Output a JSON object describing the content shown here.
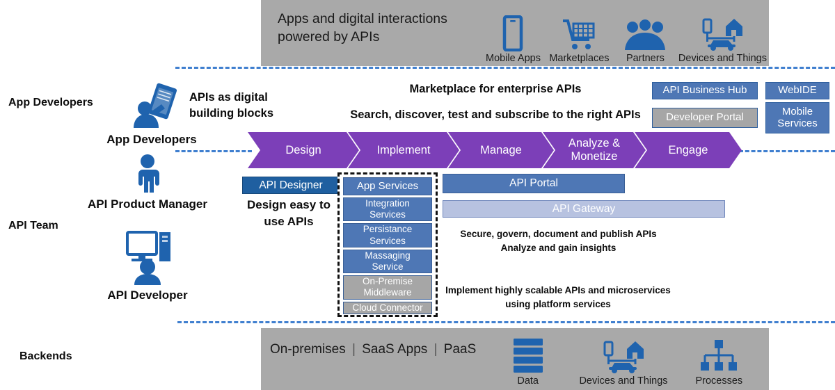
{
  "colors": {
    "band_gray": "#a9a9a9",
    "chevron_purple": "#7c3fb8",
    "bar_blue": "#4e77b5",
    "dark_blue": "#1f5fa0",
    "light_blue": "#b7c2e0",
    "gray_box": "#a6a6a6",
    "icon_blue": "#1f63ae",
    "dashed_line": "#3f7fcf"
  },
  "top_banner": {
    "title": "Apps and digital interactions\npowered by APIs",
    "icons": [
      {
        "label": "Mobile Apps",
        "icon": "mobile-phone-icon"
      },
      {
        "label": "Marketplaces",
        "icon": "shopping-cart-icon"
      },
      {
        "label": "Partners",
        "icon": "people-group-icon"
      },
      {
        "label": "Devices and Things",
        "icon": "devices-and-things-icon"
      }
    ]
  },
  "left_rail": {
    "group_app_developers": "App Developers",
    "group_api_team": "API Team",
    "group_backends": "Backends",
    "personas": [
      {
        "name": "App Developers",
        "icon": "person-with-tablet-icon"
      },
      {
        "name": "API Product Manager",
        "icon": "person-standing-icon"
      },
      {
        "name": "API Developer",
        "icon": "person-with-desktop-icon"
      }
    ]
  },
  "mid_text": {
    "building_blocks": "APIs as digital\nbuilding blocks",
    "marketplace": "Marketplace for enterprise APIs",
    "search": "Search, discover, test and subscribe to the right APIs",
    "design_easy": "Design easy to\nuse APIs",
    "secure_note": "Secure, govern, document and publish APIs\nAnalyze and gain insights",
    "implement_note": "Implement highly scalable APIs and microservices\nusing platform services"
  },
  "badges": [
    {
      "label": "API Business Hub",
      "style": "blue"
    },
    {
      "label": "WebIDE",
      "style": "blue"
    },
    {
      "label": "Developer Portal",
      "style": "gray"
    },
    {
      "label": "Mobile\nServices",
      "style": "blue"
    }
  ],
  "lifecycle": {
    "stages": [
      {
        "label": "Design"
      },
      {
        "label": "Implement"
      },
      {
        "label": "Manage"
      },
      {
        "label": "Analyze &\nMonetize"
      },
      {
        "label": "Engage"
      }
    ]
  },
  "bars": {
    "api_designer": "API Designer",
    "api_portal": "API Portal",
    "api_gateway": "API Gateway"
  },
  "service_stack": {
    "items": [
      {
        "label": "App Services",
        "style": "blue",
        "head": true
      },
      {
        "label": "Integration\nServices",
        "style": "blue"
      },
      {
        "label": "Persistance\nServices",
        "style": "blue"
      },
      {
        "label": "Massaging\nService",
        "style": "blue"
      },
      {
        "label": "On-Premise\nMiddleware",
        "style": "gray"
      },
      {
        "label": "Cloud Connector",
        "style": "gray"
      }
    ]
  },
  "bottom_banner": {
    "types": [
      "On-premises",
      "SaaS Apps",
      "PaaS"
    ],
    "icons": [
      {
        "label": "Data",
        "icon": "database-stack-icon"
      },
      {
        "label": "Devices and Things",
        "icon": "devices-and-things-icon"
      },
      {
        "label": "Processes",
        "icon": "org-chart-icon"
      }
    ]
  }
}
